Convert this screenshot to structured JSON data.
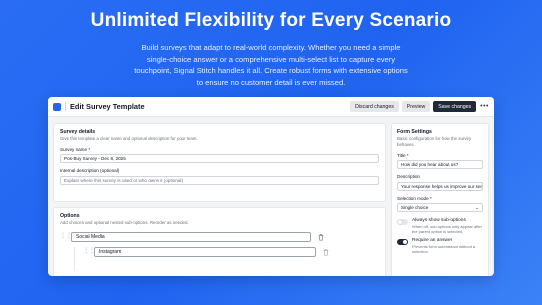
{
  "hero": {
    "title": "Unlimited Flexibility for Every Scenario",
    "subtitle": "Build surveys that adapt to real-world complexity. Whether you need a simple single-choice answer or a comprehensive multi-select list to capture every touchpoint, Signal Stitch handles it all. Create robust forms with extensive options to ensure no customer detail is ever missed."
  },
  "window": {
    "title": "Edit Survey Template",
    "discard_label": "Discard changes",
    "preview_label": "Preview",
    "save_label": "Save changes",
    "more_label": "•••"
  },
  "details": {
    "title": "Survey details",
    "description": "Give this template a clear name and optional description for your team.",
    "name_label": "Survey name *",
    "name_value": "Pos-Buy Survey - Dec 8, 2025",
    "internal_label": "Internal description (optional)",
    "internal_placeholder": "Explain where this survey is used or who owns it (optional)"
  },
  "options": {
    "title": "Options",
    "description": "Add choices and optional nested sub-options. Reorder as needed.",
    "items": [
      {
        "label": "Social Media"
      },
      {
        "label": "Instagram"
      }
    ],
    "drag_glyph": "⋮⋮"
  },
  "form_settings": {
    "title": "Form Settings",
    "description": "Basic configuration for how the survey behaves.",
    "title_label": "Title *",
    "title_value": "How did you hear about us?",
    "desc_label": "Description",
    "desc_value": "Your response helps us improve our services.",
    "mode_label": "Selection mode *",
    "mode_value": "Single choice",
    "mode_chevron": "⌄",
    "toggle_subopts_label": "Always show sub-options",
    "toggle_subopts_desc": "When off, sub-options only appear after the parent option is selected.",
    "toggle_subopts_on": false,
    "toggle_require_label": "Require an answer",
    "toggle_require_desc": "Prevents form submission without a selection.",
    "toggle_require_on": true
  },
  "colors": {
    "background": "#2a6df4",
    "primary_button": "#1f2937",
    "brand_icon": "#2563eb"
  }
}
